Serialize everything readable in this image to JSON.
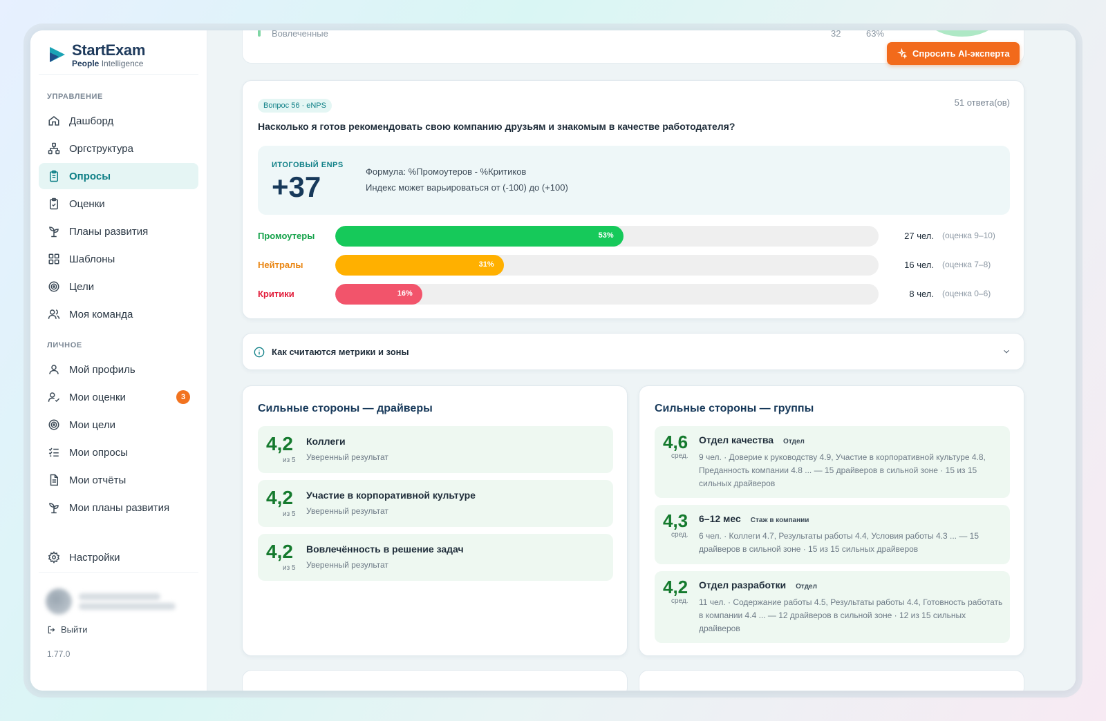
{
  "brand": {
    "name": "StartExam",
    "sub_bold": "People",
    "sub_light": "Intelligence"
  },
  "sidebar": {
    "section_manage": "Управление",
    "manage_items": [
      {
        "label": "Дашборд",
        "icon": "home-icon"
      },
      {
        "label": "Оргструктура",
        "icon": "org-structure-icon"
      },
      {
        "label": "Опросы",
        "icon": "clipboard-icon",
        "active": true
      },
      {
        "label": "Оценки",
        "icon": "clipboard-check-icon"
      },
      {
        "label": "Планы развития",
        "icon": "sprout-icon"
      },
      {
        "label": "Шаблоны",
        "icon": "grid-icon"
      },
      {
        "label": "Цели",
        "icon": "target-icon"
      },
      {
        "label": "Моя команда",
        "icon": "team-icon"
      }
    ],
    "section_personal": "Личное",
    "personal_items": [
      {
        "label": "Мой профиль",
        "icon": "user-icon"
      },
      {
        "label": "Мои оценки",
        "icon": "user-check-icon",
        "badge": "3"
      },
      {
        "label": "Мои цели",
        "icon": "target-icon"
      },
      {
        "label": "Мои опросы",
        "icon": "checklist-icon"
      },
      {
        "label": "Мои отчёты",
        "icon": "report-icon"
      },
      {
        "label": "Мои планы развития",
        "icon": "sprout-icon"
      }
    ],
    "settings_label": "Настройки",
    "logout_label": "Выйти",
    "version": "1.77.0"
  },
  "top_card": {
    "label": "Вовлеченные",
    "count": "32",
    "percent": "63%"
  },
  "ai_button": {
    "label": "Спросить AI-эксперта"
  },
  "enps": {
    "tag": "Вопрос 56 · eNPS",
    "answers": "51 ответа(ов)",
    "question": "Насколько я готов рекомендовать свою компанию друзьям и знакомым в качестве работодателя?",
    "score_label": "ИТОГОВЫЙ ENPS",
    "score_value": "+37",
    "formula": "Формула: %Промоутеров - %Критиков",
    "range_note": "Индекс может варьироваться от (-100) до (+100)",
    "rows": [
      {
        "label": "Промоутеры",
        "pct_text": "53%",
        "pct": 0.53,
        "count": "27 чел.",
        "range": "(оценка 9–10)",
        "color": "#16c95a",
        "label_color": "#15a24a"
      },
      {
        "label": "Нейтралы",
        "pct_text": "31%",
        "pct": 0.31,
        "count": "16 чел.",
        "range": "(оценка 7–8)",
        "color": "#ffb000",
        "label_color": "#e98511"
      },
      {
        "label": "Критики",
        "pct_text": "16%",
        "pct": 0.16,
        "count": "8 чел.",
        "range": "(оценка 0–6)",
        "color": "#f2546b",
        "label_color": "#e21c3a"
      }
    ]
  },
  "metrics_info": {
    "label": "Как считаются метрики и зоны"
  },
  "strong_drivers": {
    "title": "Сильные стороны — драйверы",
    "items": [
      {
        "score": "4,2",
        "sub": "из 5",
        "name": "Коллеги",
        "desc": "Уверенный результат"
      },
      {
        "score": "4,2",
        "sub": "из 5",
        "name": "Участие в корпоративной культуре",
        "desc": "Уверенный результат"
      },
      {
        "score": "4,2",
        "sub": "из 5",
        "name": "Вовлечённость в решение задач",
        "desc": "Уверенный результат"
      }
    ]
  },
  "strong_groups": {
    "title": "Сильные стороны — группы",
    "items": [
      {
        "score": "4,6",
        "sub": "сред.",
        "name": "Отдел качества",
        "tag": "Отдел",
        "desc": "9 чел. · Доверие к руководству 4.9, Участие в корпоративной культуре 4.8, Преданность компании 4.8 ... — 15 драйверов в сильной зоне · 15 из 15 сильных драйверов"
      },
      {
        "score": "4,3",
        "sub": "сред.",
        "name": "6–12 мес",
        "tag": "Стаж в компании",
        "desc": "6 чел. · Коллеги 4.7, Результаты работы 4.4, Условия работы 4.3 ... — 15 драйверов в сильной зоне · 15 из 15 сильных драйверов"
      },
      {
        "score": "4,2",
        "sub": "сред.",
        "name": "Отдел разработки",
        "tag": "Отдел",
        "desc": "11 чел. · Содержание работы 4.5, Результаты работы 4.4, Готовность работать в компании 4.4 ... — 12 драйверов в сильной зоне · 12 из 15 сильных драйверов"
      }
    ]
  },
  "colors": {
    "accent": "#0e7f86",
    "orange": "#f26a1b",
    "green_score": "#157a2e"
  }
}
